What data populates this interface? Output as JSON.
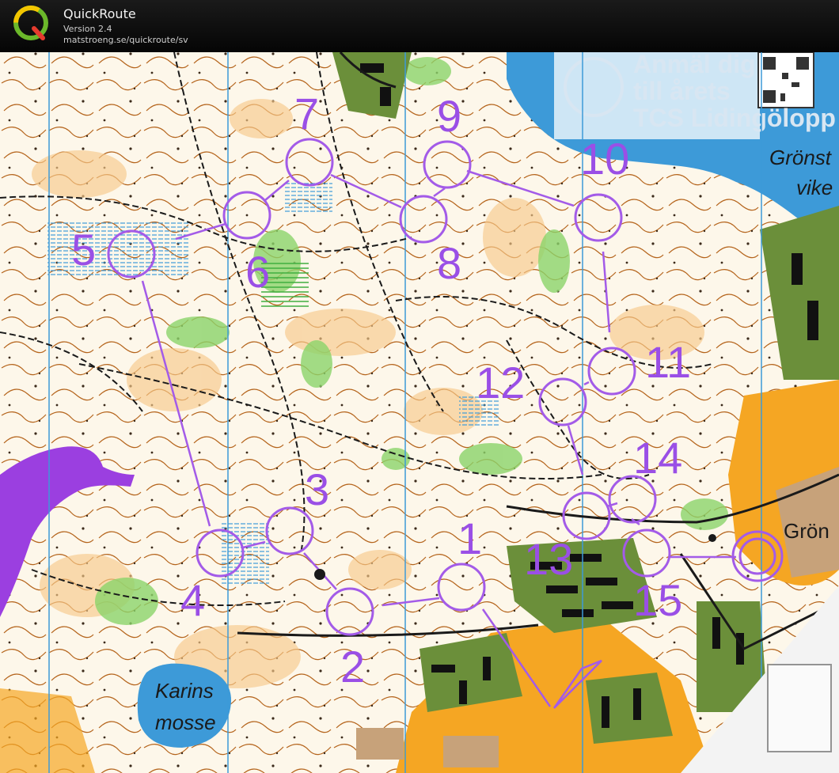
{
  "app": {
    "name": "QuickRoute",
    "version": "Version 2.4",
    "url": "matstroeng.se/quickroute/sv",
    "logo_letter": "Q"
  },
  "map": {
    "place_labels": {
      "gronst": "Grönst",
      "vike": "vike",
      "gron": "Grön",
      "karins": "Karins",
      "mosse": "mosse"
    },
    "ad_text": [
      "Anmäl dig",
      "till årets",
      "TCS Lidingölopp"
    ],
    "controls": [
      "1",
      "2",
      "3",
      "4",
      "5",
      "6",
      "7",
      "8",
      "9",
      "10",
      "11",
      "12",
      "13",
      "14",
      "15"
    ],
    "colors": {
      "course": "#a35be8",
      "water": "#3d9ad8",
      "open_land": "#f7c98a",
      "forest": "#ffffff",
      "green": "#8bd36a",
      "urban": "#f5a623",
      "contours": "#b5651d",
      "start_area": "#9b3fe0"
    }
  }
}
